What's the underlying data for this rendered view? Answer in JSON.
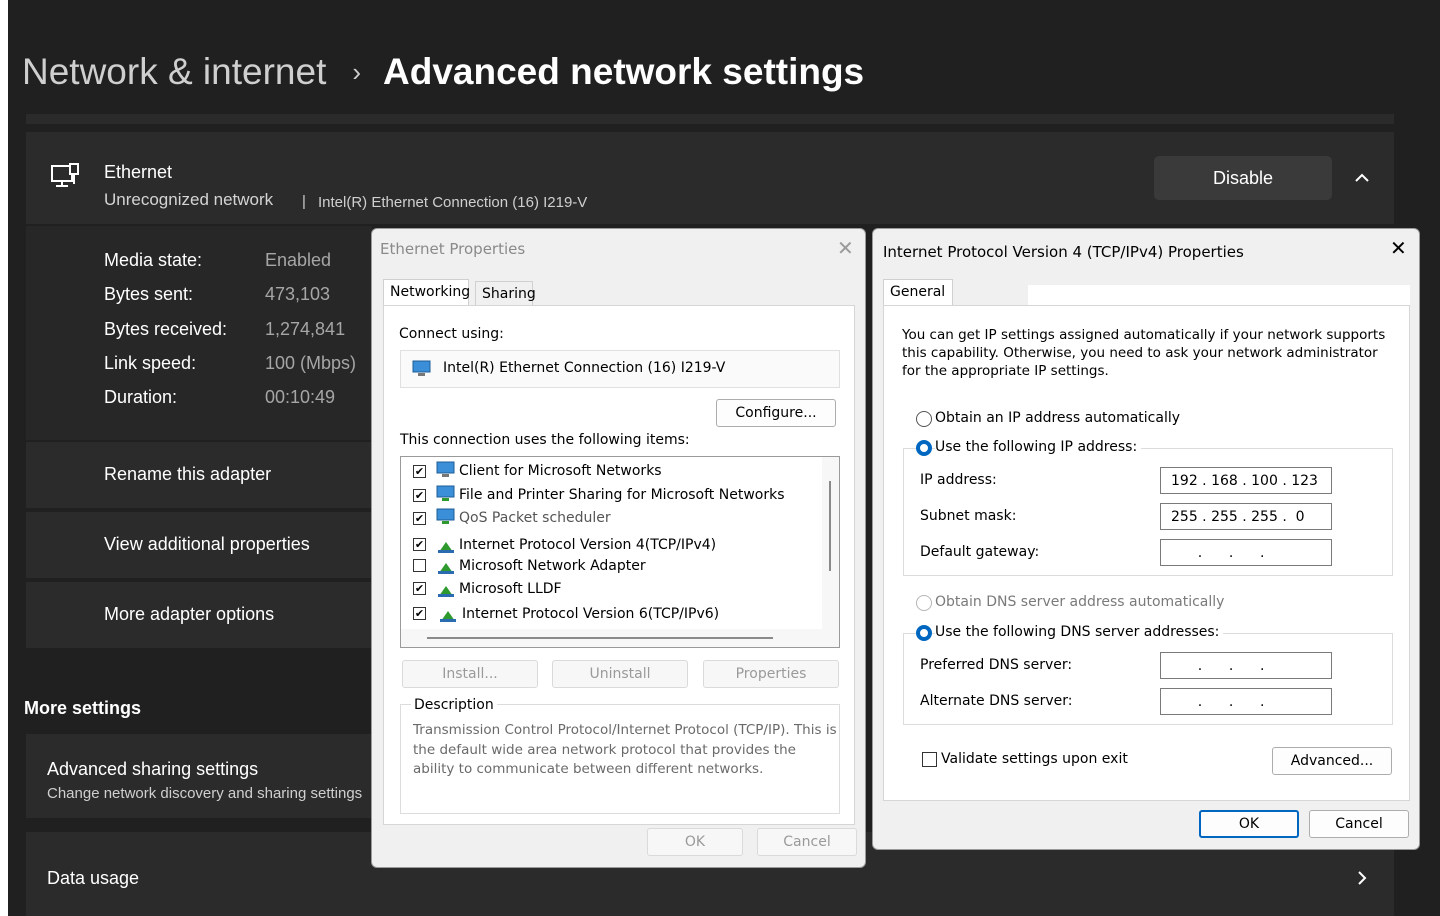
{
  "settings": {
    "breadcrumb": {
      "parent": "Network & internet",
      "separator": "›",
      "current": "Advanced network settings"
    },
    "ethernet": {
      "name": "Ethernet",
      "status": "Unrecognized network",
      "separator": "|",
      "adapter": "Intel(R) Ethernet Connection (16) I219-V",
      "disable_label": "Disable",
      "icon": "ethernet-icon",
      "expand_icon": "chevron-up-icon"
    },
    "details": [
      {
        "label": "Media state:",
        "value": "Enabled"
      },
      {
        "label": "Bytes sent:",
        "value": "473,103"
      },
      {
        "label": "Bytes received:",
        "value": "1,274,841"
      },
      {
        "label": "Link speed:",
        "value": "100 (Mbps)"
      },
      {
        "label": "Duration:",
        "value": "00:10:49"
      }
    ],
    "actions": [
      "Rename this adapter",
      "View additional properties",
      "More adapter options"
    ],
    "more_settings_heading": "More settings",
    "sharing": {
      "title": "Advanced sharing settings",
      "subtitle": "Change network discovery and sharing settings"
    },
    "data_usage": {
      "label": "Data usage",
      "icon": "chevron-right-icon"
    }
  },
  "ethernet_properties": {
    "title": "Ethernet Properties",
    "close": "✕",
    "tabs": [
      "Networking",
      "Sharing"
    ],
    "connect_using_label": "Connect using:",
    "adapter_name": "Intel(R) Ethernet Connection (16) I219-V",
    "configure_label": "Configure...",
    "items_label": "This connection uses the following items:",
    "items": [
      {
        "label": "Client for Microsoft Networks",
        "checked": true,
        "icon": "client-network-icon"
      },
      {
        "label": "File and Printer Sharing for Microsoft Networks",
        "checked": true,
        "icon": "file-sharing-icon"
      },
      {
        "label": "QoS Packet scheduler",
        "checked": true,
        "icon": "qos-icon"
      },
      {
        "label": "Internet Protocol Version 4(TCP/IPv4)",
        "checked": true,
        "icon": "protocol-icon"
      },
      {
        "label": "Microsoft Network Adapter",
        "checked": false,
        "icon": "protocol-icon"
      },
      {
        "label": "Microsoft LLDF",
        "checked": true,
        "icon": "protocol-icon"
      },
      {
        "label": "Internet Protocol Version 6(TCP/IPv6)",
        "checked": true,
        "icon": "protocol-icon"
      }
    ],
    "buttons": {
      "install": "Install...",
      "uninstall": "Uninstall",
      "properties": "Properties"
    },
    "description_label": "Description",
    "description_text": "Transmission Control Protocol/Internet Protocol (TCP/IP). This is the default wide area network protocol that provides the ability to communicate between different networks.",
    "ok": "OK",
    "cancel": "Cancel"
  },
  "ipv4_properties": {
    "title": "Internet Protocol Version 4 (TCP/IPv4) Properties",
    "close": "✕",
    "tab": "General",
    "intro": "You can get IP settings assigned automatically if your network supports this capability. Otherwise, you need to ask your network administrator for the appropriate IP settings.",
    "obtain_ip_auto": "Obtain an IP address automatically",
    "use_following_ip": "Use the following IP address:",
    "ip_address_label": "IP address:",
    "ip_address_value": "192 . 168 . 100 . 123",
    "subnet_mask_label": "Subnet mask:",
    "subnet_mask_value": "255 . 255 . 255 .  0",
    "default_gateway_label": "Default gateway:",
    "default_gateway_value": "      .      .      .",
    "obtain_dns_auto": "Obtain DNS server address automatically",
    "use_following_dns": "Use the following DNS server addresses:",
    "preferred_dns_label": "Preferred DNS server:",
    "preferred_dns_value": "      .      .      .",
    "alternate_dns_label": "Alternate DNS server:",
    "alternate_dns_value": "      .      .      .",
    "validate_label": "Validate settings upon exit",
    "advanced_label": "Advanced...",
    "ok": "OK",
    "cancel": "Cancel",
    "accent_color": "#0067c0"
  }
}
